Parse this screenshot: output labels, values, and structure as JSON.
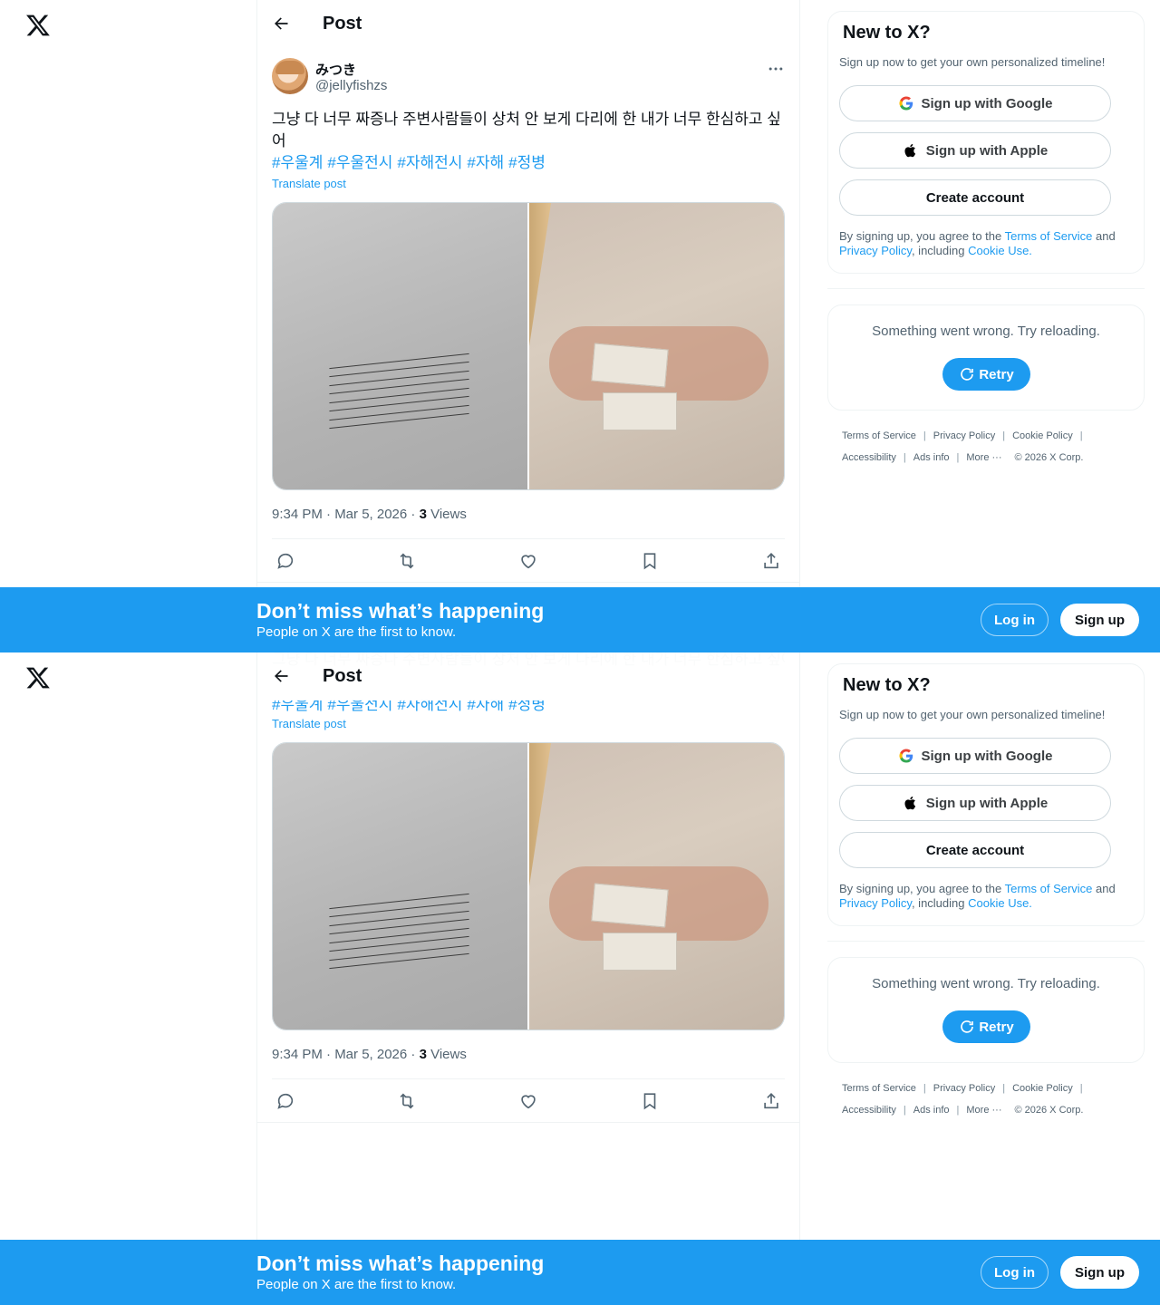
{
  "header": {
    "title": "Post"
  },
  "post": {
    "display_name": "みつき",
    "handle": "@jellyfishzs",
    "text": "그냥 다 너무 짜증나 주변사람들이 상처 안 보게 다리에 한 내가 너무 한심하고 싶어",
    "hashtags": [
      "#우울계",
      "#우울전시",
      "#자해전시",
      "#자해",
      "#정병"
    ],
    "translate_label": "Translate post",
    "time": "9:34 PM · Mar 5, 2026 · ",
    "views_count": "3",
    "views_label": " Views"
  },
  "actions": [
    "reply-icon",
    "repost-icon",
    "like-icon",
    "bookmark-icon",
    "share-icon"
  ],
  "sidebar": {
    "signup_card": {
      "title": "New to X?",
      "subtitle": "Sign up now to get your own personalized timeline!",
      "google_label": "Sign up with Google",
      "apple_label": "Sign up with Apple",
      "create_label": "Create account",
      "legal_prefix": "By signing up, you agree to the ",
      "tos": "Terms of Service",
      "and": " and ",
      "privacy": "Privacy Policy",
      "including": ", including ",
      "cookie": "Cookie Use."
    },
    "error_card": {
      "message": "Something went wrong. Try reloading.",
      "retry_label": "Retry"
    },
    "footer": {
      "tos": "Terms of Service",
      "privacy": "Privacy Policy",
      "cookie": "Cookie Policy",
      "accessibility": "Accessibility",
      "ads": "Ads info",
      "more": "More ···",
      "copyright": "© 2026 X Corp."
    }
  },
  "banner": {
    "headline": "Don’t miss what’s happening",
    "subline": "People on X are the first to know.",
    "login_label": "Log in",
    "signup_label": "Sign up"
  },
  "colors": {
    "accent": "#1d9bf0",
    "text": "#0f1419",
    "muted": "#536471",
    "border": "#eff3f4"
  }
}
